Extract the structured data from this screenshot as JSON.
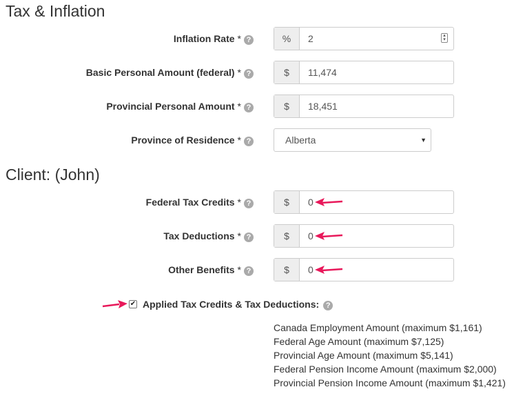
{
  "tax_section": {
    "title": "Tax & Inflation",
    "fields": [
      {
        "label": "Inflation Rate",
        "required": "*",
        "addon": "%",
        "value": "2"
      },
      {
        "label": "Basic Personal Amount (federal)",
        "required": "*",
        "addon": "$",
        "value": "11,474"
      },
      {
        "label": "Provincial Personal Amount",
        "required": "*",
        "addon": "$",
        "value": "18,451"
      }
    ],
    "province": {
      "label": "Province of Residence",
      "required": "*",
      "selected": "Alberta"
    }
  },
  "client_section": {
    "title": "Client: (John)",
    "fields": [
      {
        "label": "Federal Tax Credits",
        "required": "*",
        "addon": "$",
        "value": "0"
      },
      {
        "label": "Tax Deductions",
        "required": "*",
        "addon": "$",
        "value": "0"
      },
      {
        "label": "Other Benefits",
        "required": "*",
        "addon": "$",
        "value": "0"
      }
    ],
    "applied_checkbox": {
      "label": "Applied Tax Credits & Tax Deductions:",
      "checked": true
    },
    "credits": [
      "Canada Employment Amount (maximum $1,161)",
      "Federal Age Amount (maximum $7,125)",
      "Provincial Age Amount (maximum $5,141)",
      "Federal Pension Income Amount (maximum $2,000)",
      "Provincial Pension Income Amount (maximum $1,421)"
    ]
  },
  "icons": {
    "help": "?",
    "check": "✔",
    "caret": "▼"
  },
  "colors": {
    "annotation_arrow": "#e8185a",
    "addon_bg": "#eeeeee",
    "border": "#cccccc"
  }
}
